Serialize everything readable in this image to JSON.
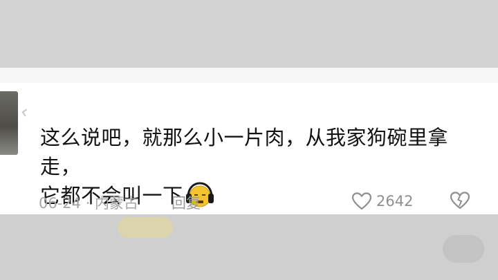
{
  "comment": {
    "text_line1": "这么说吧，就那么小一片肉，从我家狗碗里拿走，",
    "text_line2": "它都不会叫一下",
    "emoji_icon": "yellow-face-headphones-icon",
    "date_location": "06-24 · 内蒙古",
    "reply_label": "回复",
    "like_count": "2642"
  },
  "colors": {
    "text": "#121212",
    "meta": "#a5a5a5",
    "emoji_yellow": "#f3c42d"
  }
}
